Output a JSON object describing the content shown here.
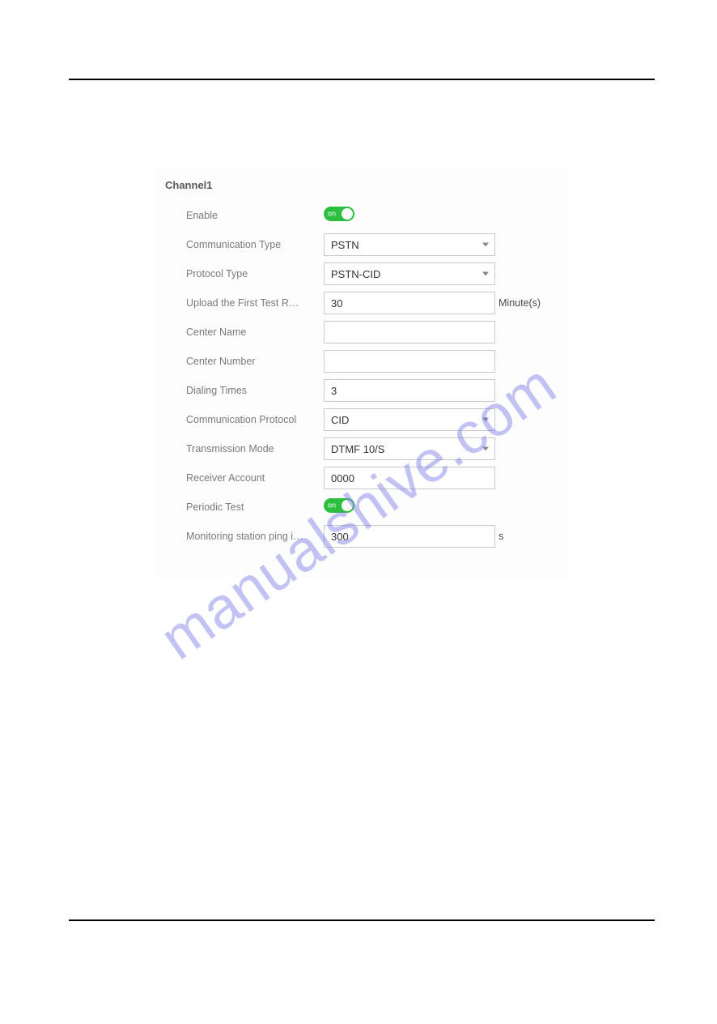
{
  "watermark": "manualshive.com",
  "panel": {
    "title": "Channel1",
    "rows": {
      "enable": {
        "label": "Enable",
        "toggle_text": "on"
      },
      "commType": {
        "label": "Communication Type",
        "value": "PSTN"
      },
      "protoType": {
        "label": "Protocol Type",
        "value": "PSTN-CID"
      },
      "upload": {
        "label": "Upload the First Test R…",
        "value": "30",
        "unit": "Minute(s)"
      },
      "cName": {
        "label": "Center Name",
        "value": ""
      },
      "cNumber": {
        "label": "Center Number",
        "value": ""
      },
      "dialing": {
        "label": "Dialing Times",
        "value": "3"
      },
      "commProto": {
        "label": "Communication Protocol",
        "value": "CID"
      },
      "transMode": {
        "label": "Transmission Mode",
        "value": "DTMF 10/S"
      },
      "receiver": {
        "label": "Receiver Account",
        "value": "0000"
      },
      "periodic": {
        "label": "Periodic Test",
        "toggle_text": "on"
      },
      "monitor": {
        "label": "Monitoring station ping i…",
        "value": "300",
        "unit": "s"
      }
    }
  }
}
